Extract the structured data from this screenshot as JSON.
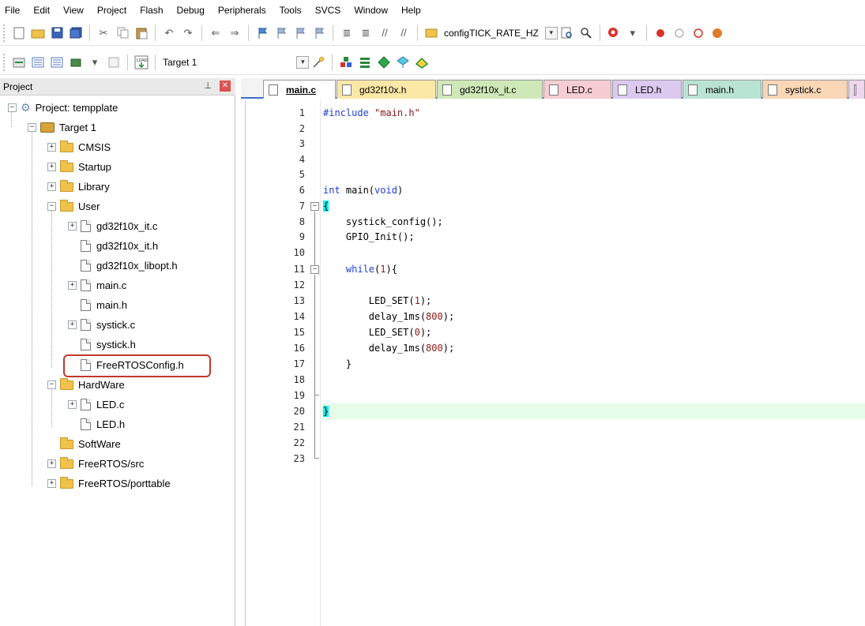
{
  "menu": {
    "items": [
      "File",
      "Edit",
      "View",
      "Project",
      "Flash",
      "Debug",
      "Peripherals",
      "Tools",
      "SVCS",
      "Window",
      "Help"
    ]
  },
  "toolbar1": {
    "find_combo_value": "configTICK_RATE_HZ"
  },
  "toolbar2": {
    "target_label": "Target 1",
    "load_label": "LOAD"
  },
  "project_pane": {
    "title": "Project",
    "pin_glyph": "ᵖ",
    "close_glyph": "✕",
    "tree": {
      "root": "Project: tempplate",
      "target": "Target 1",
      "groups": {
        "cmsis": "CMSIS",
        "startup": "Startup",
        "library": "Library",
        "user": "User",
        "hardware": "HardWare",
        "software": "SoftWare",
        "freertos_src": "FreeRTOS/src",
        "freertos_port": "FreeRTOS/porttable"
      },
      "user_files": [
        "gd32f10x_it.c",
        "gd32f10x_it.h",
        "gd32f10x_libopt.h",
        "main.c",
        "main.h",
        "systick.c",
        "systick.h",
        "FreeRTOSConfig.h"
      ],
      "hardware_files": [
        "LED.c",
        "LED.h"
      ]
    },
    "highlight_color": "#c0392b"
  },
  "editor": {
    "tabs": [
      {
        "label": "main.c",
        "color": "#ffffff"
      },
      {
        "label": "gd32f10x.h",
        "color": "#fbe8a6"
      },
      {
        "label": "gd32f10x_it.c",
        "color": "#cfe8b8"
      },
      {
        "label": "LED.c",
        "color": "#f6cdd2"
      },
      {
        "label": "LED.h",
        "color": "#dcc9ef"
      },
      {
        "label": "main.h",
        "color": "#b9e3d3"
      },
      {
        "label": "systick.c",
        "color": "#f8d6b6"
      }
    ],
    "line_numbers": [
      "1",
      "2",
      "3",
      "4",
      "5",
      "6",
      "7",
      "8",
      "9",
      "10",
      "11",
      "12",
      "13",
      "14",
      "15",
      "16",
      "17",
      "18",
      "19",
      "20",
      "21",
      "22",
      "23"
    ],
    "code": {
      "l1_directive": "#include",
      "l1_string": "\"main.h\"",
      "l6_kw_int": "int",
      "l6_mid": " main(",
      "l6_kw_void": "void",
      "l6_end": ")",
      "l7_brace": "{",
      "l8": "    systick_config();",
      "l9": "    GPIO_Init();",
      "l11_kw": "while",
      "l11_open": "(",
      "l11_num": "1",
      "l11_close": "){",
      "l13_a": "        LED_SET(",
      "l13_num": "1",
      "l13_b": ");",
      "l14_a": "        delay_1ms(",
      "l14_num": "800",
      "l14_b": ");",
      "l15_a": "        LED_SET(",
      "l15_num": "0",
      "l15_b": ");",
      "l16_a": "        delay_1ms(",
      "l16_num": "800",
      "l16_b": ");",
      "l17": "    }",
      "l20_brace": "}"
    },
    "highlight_line_color": "#e6fbe8",
    "keyword_color": "#1f3fd6",
    "literal_color": "#8b1a1a"
  }
}
